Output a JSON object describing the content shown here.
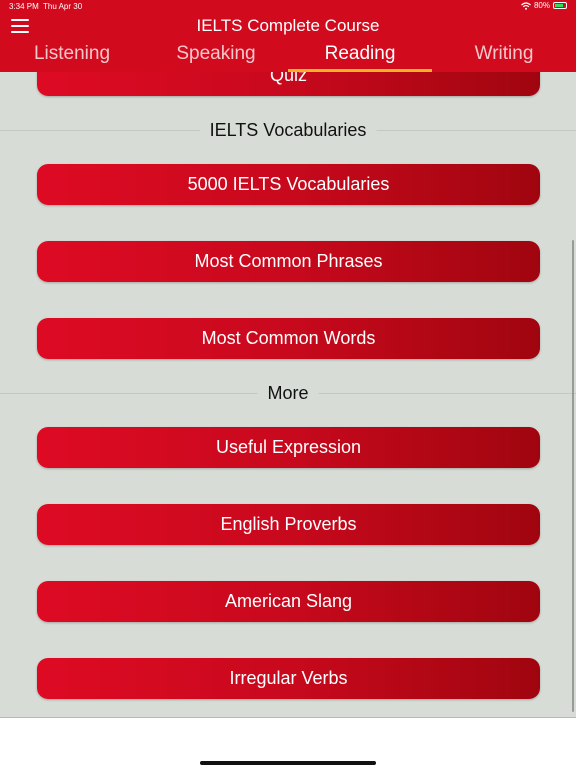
{
  "status_bar": {
    "time": "3:34 PM",
    "date": "Thu Apr 30",
    "battery": "80%",
    "wifi_icon": "wifi-icon",
    "battery_icon": "battery-icon"
  },
  "header": {
    "title": "IELTS Complete Course",
    "menu_icon": "hamburger-menu-icon",
    "background": "#d10a1e",
    "indicator_color": "#f2b320"
  },
  "tabs": [
    {
      "label": "Listening"
    },
    {
      "label": "Speaking"
    },
    {
      "label": "Reading",
      "active": true
    },
    {
      "label": "Writing"
    }
  ],
  "content": {
    "partial_button": "Quiz",
    "sections": [
      {
        "title": "IELTS Vocabularies",
        "buttons": [
          "5000 IELTS Vocabularies",
          "Most Common Phrases",
          "Most Common Words"
        ]
      },
      {
        "title": "More",
        "buttons": [
          "Useful Expression",
          "English Proverbs",
          "American Slang",
          "Irregular Verbs"
        ]
      }
    ]
  }
}
